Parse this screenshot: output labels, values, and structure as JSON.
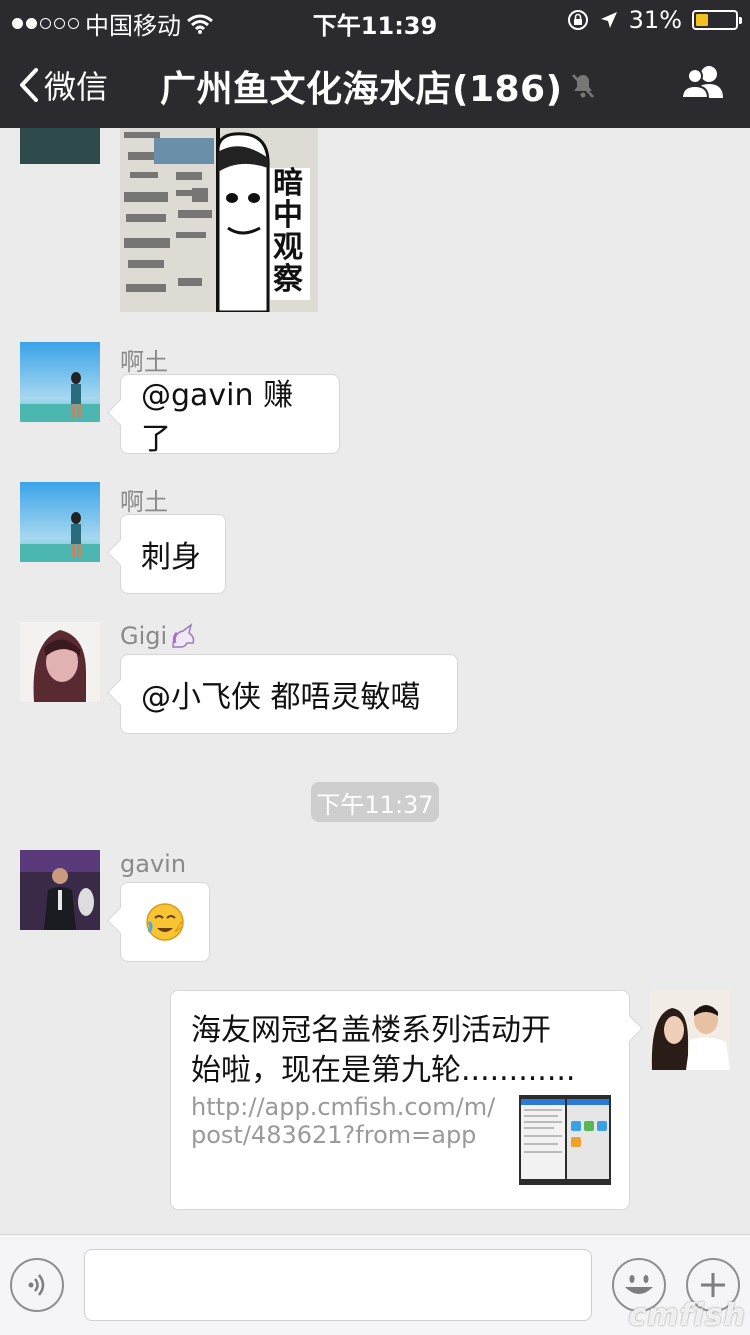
{
  "status": {
    "carrier": "中国移动",
    "time": "下午11:39",
    "battery": "31%",
    "battery_level": 0.31
  },
  "nav": {
    "back_label": "微信",
    "title": "广州鱼文化海水店(186)"
  },
  "messages": {
    "sticker_text": "暗中观察",
    "m1": {
      "sender": "啊土",
      "text": "@gavin 赚了"
    },
    "m2": {
      "sender": "啊土",
      "text": "刺身"
    },
    "m3": {
      "sender": "Gigi",
      "text": "@小飞侠 都唔灵敏噶"
    },
    "time_label": "下午11:37",
    "m4": {
      "sender": "gavin",
      "emoji": "😭"
    },
    "link": {
      "title_line1": "海友网冠名盖楼系列活动开",
      "title_line2": "始啦，现在是第九轮............",
      "url_line1": "http://app.cmfish.com/m/",
      "url_line2": "post/483621?from=app"
    }
  },
  "watermark": "cmfish",
  "colors": {
    "nav_bg": "#2b2b2f",
    "chat_bg": "#ebebeb",
    "bubble": "#ffffff",
    "battery": "#f4c020"
  }
}
